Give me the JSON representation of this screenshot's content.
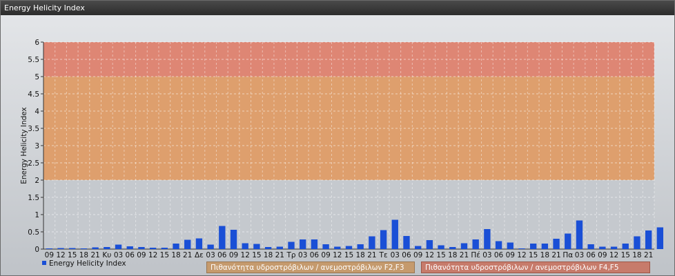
{
  "window": {
    "title": "Energy Helicity Index"
  },
  "chart_data": {
    "type": "bar",
    "ylabel": "Energy Helicity Index",
    "ylim": [
      0,
      6
    ],
    "yticks": [
      "0",
      "0.5",
      "1",
      "1.5",
      "2",
      "2.5",
      "3",
      "3.5",
      "4",
      "4.5",
      "5",
      "5.5",
      "6"
    ],
    "categories": [
      "09",
      "12",
      "15",
      "18",
      "21",
      "Κυ",
      "03",
      "06",
      "09",
      "12",
      "15",
      "18",
      "21",
      "Δε",
      "03",
      "06",
      "09",
      "12",
      "15",
      "18",
      "21",
      "Τρ",
      "03",
      "06",
      "09",
      "12",
      "15",
      "18",
      "21",
      "Τε",
      "03",
      "06",
      "09",
      "12",
      "15",
      "18",
      "21",
      "Πέ",
      "03",
      "06",
      "09",
      "12",
      "15",
      "18",
      "21",
      "Πα",
      "03",
      "06",
      "09",
      "12",
      "15",
      "18",
      "21"
    ],
    "series": [
      {
        "name": "Energy Helicity Index",
        "color": "#1a4fd6",
        "values": [
          0.02,
          0.03,
          0.03,
          0.02,
          0.05,
          0.06,
          0.13,
          0.08,
          0.06,
          0.04,
          0.04,
          0.16,
          0.27,
          0.31,
          0.13,
          0.67,
          0.56,
          0.17,
          0.15,
          0.06,
          0.07,
          0.21,
          0.28,
          0.28,
          0.14,
          0.07,
          0.09,
          0.14,
          0.37,
          0.55,
          0.85,
          0.38,
          0.09,
          0.26,
          0.11,
          0.06,
          0.17,
          0.28,
          0.58,
          0.23,
          0.19,
          0.02,
          0.16,
          0.16,
          0.3,
          0.45,
          0.83,
          0.14,
          0.07,
          0.07,
          0.16,
          0.37,
          0.54,
          0.63
        ]
      }
    ],
    "bands": [
      {
        "from": 2,
        "to": 5,
        "color": "#e09a63",
        "label": "Πιθανότητα υδροστρόβιλων / ανεμοστρόβιλων F2,F3"
      },
      {
        "from": 5,
        "to": 6,
        "color": "#e07e6a",
        "label": "Πιθανότητα υδροστρόβιλων / ανεμοστρόβιλων F4,F5"
      }
    ],
    "grid": true,
    "legend": "bottom-left"
  }
}
